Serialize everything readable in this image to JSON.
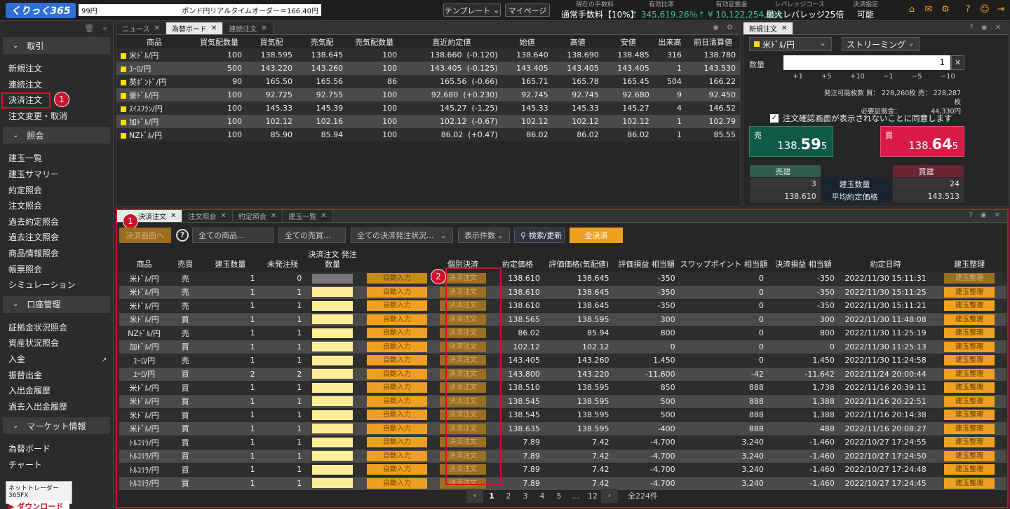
{
  "topbar": {
    "logo": "くりっく365",
    "ticker_left": "99円",
    "ticker_right": "ポンド円リアルタイムオーダー＝166.40円",
    "template_btn": "テンプレート",
    "mypage_btn": "マイページ",
    "fee_label": "現在の手数料",
    "fee_value": "通常手数料【10%】",
    "ratio_label": "有効比率",
    "ratio_value": "345,619.26％",
    "margin_label": "有効証拠金",
    "margin_value": "¥ 10,122,254,991",
    "lev_label": "レバレッジコース",
    "lev_value": "最大レバレッジ25倍",
    "settle_label": "決済指定",
    "settle_value": "可能"
  },
  "sidebar": {
    "sections": [
      {
        "title": "取引",
        "items": [
          "新規注文",
          "連続注文",
          "決済注文",
          "注文変更・取消"
        ]
      },
      {
        "title": "照会",
        "items": [
          "建玉一覧",
          "建玉サマリー",
          "約定照会",
          "注文照会",
          "過去約定照会",
          "過去注文照会",
          "商品情報照会",
          "帳票照会",
          "シミュレーション"
        ]
      },
      {
        "title": "口座管理",
        "items": [
          "証拠金状況照会",
          "資産状況照会",
          "入金",
          "振替出金",
          "入出金履歴",
          "過去入出金履歴"
        ]
      },
      {
        "title": "マーケット情報",
        "items": [
          "為替ボード",
          "チャート"
        ]
      }
    ],
    "download_label": "ネットトレーダー365FX",
    "download_btn": "ダウンロード",
    "badge1": "1"
  },
  "rateboard": {
    "tabs": [
      "ニュース",
      "為替ボード",
      "連続注文"
    ],
    "headers": [
      "商品",
      "買気配数量",
      "買気配",
      "売気配",
      "売気配数量",
      "直近約定値",
      "始値",
      "高値",
      "安値",
      "出来高",
      "前日清算値"
    ],
    "rows": [
      [
        "米ﾄﾞﾙ/円",
        "100",
        "138.595",
        "138.645",
        "100",
        "138.660",
        "(-0.120)",
        "138.640",
        "138.690",
        "138.485",
        "316",
        "138.780"
      ],
      [
        "ﾕｰﾛ/円",
        "500",
        "143.220",
        "143.260",
        "100",
        "143.405",
        "(-0.125)",
        "143.405",
        "143.405",
        "143.405",
        "1",
        "143.530"
      ],
      [
        "英ﾎﾟﾝﾄﾞ/円",
        "90",
        "165.50",
        "165.56",
        "86",
        "165.56",
        "(-0.66)",
        "165.71",
        "165.78",
        "165.45",
        "504",
        "166.22"
      ],
      [
        "豪ﾄﾞﾙ/円",
        "100",
        "92.725",
        "92.755",
        "100",
        "92.680",
        "(+0.230)",
        "92.745",
        "92.745",
        "92.680",
        "9",
        "92.450"
      ],
      [
        "ｽｲｽﾌﾗﾝ/円",
        "100",
        "145.33",
        "145.39",
        "100",
        "145.27",
        "(-1.25)",
        "145.33",
        "145.33",
        "145.27",
        "4",
        "146.52"
      ],
      [
        "加ﾄﾞﾙ/円",
        "100",
        "102.12",
        "102.16",
        "100",
        "102.12",
        "(-0.67)",
        "102.12",
        "102.12",
        "102.12",
        "1",
        "102.79"
      ],
      [
        "NZﾄﾞﾙ/円",
        "100",
        "85.90",
        "85.94",
        "100",
        "86.02",
        "(+0.47)",
        "86.02",
        "86.02",
        "86.02",
        "1",
        "85.55"
      ]
    ]
  },
  "neworder": {
    "tab": "新規注文",
    "pair": "米ﾄﾞﾙ/円",
    "mode": "ストリーミング",
    "qty_label": "数量",
    "qty_value": "1",
    "steps": [
      "+1",
      "+5",
      "+10",
      "−1",
      "−5",
      "−10"
    ],
    "avail": "発注可能枚数 買： 228,260枚 売： 228,287枚",
    "req_margin": "必要証拠金：　　　　　44,330円",
    "confirm": "注文確認画面が表示されないことに同意します",
    "sell_label": "売",
    "sell_main": "138.",
    "sell_big": "59",
    "sell_small": "5",
    "buy_label": "買",
    "buy_main": "138.",
    "buy_big": "64",
    "buy_small": "5",
    "pos_headers": [
      "売建",
      "",
      "買建"
    ],
    "pos_qty": [
      "3",
      "建玉数量",
      "24"
    ],
    "pos_avg": [
      "138.610",
      "平均約定価格",
      "143.513"
    ]
  },
  "settle": {
    "tabs": [
      "決済注文",
      "注文照会",
      "約定照会",
      "建玉一覧"
    ],
    "filters": {
      "back": "決済画面へ",
      "help": "?",
      "product": "全ての商品...",
      "side": "全ての売買...",
      "status": "全ての決済発注状況...",
      "count": "表示件数",
      "search": "検索/更新",
      "all": "全決済"
    },
    "headers": [
      "商品",
      "売買",
      "建玉数量",
      "未発注残",
      "決済注文 発注数量",
      "",
      "個別決済",
      "約定価格",
      "評価価格(気配値)",
      "評価損益 相当額",
      "スワップポイント 相当額",
      "決済損益 相当額",
      "約定日時",
      "建玉整理"
    ],
    "auto": "自動入力",
    "settle_btn": "決済注文",
    "org_btn": "建玉整理",
    "rows": [
      [
        "米ﾄﾞﾙ/円",
        "売",
        "1",
        "0",
        "138.610",
        "138.645",
        "-350",
        "0",
        "-350",
        "2022/11/30 15:11:31"
      ],
      [
        "米ﾄﾞﾙ/円",
        "売",
        "1",
        "1",
        "138.610",
        "138.645",
        "-350",
        "0",
        "-350",
        "2022/11/30 15:11:25"
      ],
      [
        "米ﾄﾞﾙ/円",
        "売",
        "1",
        "1",
        "138.610",
        "138.645",
        "-350",
        "0",
        "-350",
        "2022/11/30 15:11:21"
      ],
      [
        "米ﾄﾞﾙ/円",
        "買",
        "1",
        "1",
        "138.565",
        "138.595",
        "300",
        "0",
        "300",
        "2022/11/30 11:48:08"
      ],
      [
        "NZﾄﾞﾙ/円",
        "売",
        "1",
        "1",
        "86.02",
        "85.94",
        "800",
        "0",
        "800",
        "2022/11/30 11:25:19"
      ],
      [
        "加ﾄﾞﾙ/円",
        "買",
        "1",
        "1",
        "102.12",
        "102.12",
        "0",
        "0",
        "0",
        "2022/11/30 11:25:13"
      ],
      [
        "ﾕｰﾛ/円",
        "売",
        "1",
        "1",
        "143.405",
        "143.260",
        "1,450",
        "0",
        "1,450",
        "2022/11/30 11:24:58"
      ],
      [
        "ﾕｰﾛ/円",
        "買",
        "2",
        "2",
        "143.800",
        "143.220",
        "-11,600",
        "-42",
        "-11,642",
        "2022/11/24 20:00:44"
      ],
      [
        "米ﾄﾞﾙ/円",
        "買",
        "1",
        "1",
        "138.510",
        "138.595",
        "850",
        "888",
        "1,738",
        "2022/11/16 20:39:11"
      ],
      [
        "米ﾄﾞﾙ/円",
        "買",
        "1",
        "1",
        "138.545",
        "138.595",
        "500",
        "888",
        "1,388",
        "2022/11/16 20:22:51"
      ],
      [
        "米ﾄﾞﾙ/円",
        "買",
        "1",
        "1",
        "138.545",
        "138.595",
        "500",
        "888",
        "1,388",
        "2022/11/16 20:14:38"
      ],
      [
        "米ﾄﾞﾙ/円",
        "買",
        "1",
        "1",
        "138.635",
        "138.595",
        "-400",
        "888",
        "488",
        "2022/11/16 20:08:27"
      ],
      [
        "ﾄﾙｺﾘﾗ/円",
        "買",
        "1",
        "1",
        "7.89",
        "7.42",
        "-4,700",
        "3,240",
        "-1,460",
        "2022/10/27 17:24:55"
      ],
      [
        "ﾄﾙｺﾘﾗ/円",
        "買",
        "1",
        "1",
        "7.89",
        "7.42",
        "-4,700",
        "3,240",
        "-1,460",
        "2022/10/27 17:24:50"
      ],
      [
        "ﾄﾙｺﾘﾗ/円",
        "買",
        "1",
        "1",
        "7.89",
        "7.42",
        "-4,700",
        "3,240",
        "-1,460",
        "2022/10/27 17:24:48"
      ],
      [
        "ﾄﾙｺﾘﾗ/円",
        "買",
        "1",
        "1",
        "7.89",
        "7.42",
        "-4,700",
        "3,240",
        "-1,460",
        "2022/10/27 17:24:45"
      ]
    ],
    "pager": {
      "prev": "‹",
      "pages": [
        "1",
        "2",
        "3",
        "4",
        "5",
        "…",
        "12"
      ],
      "next": "›",
      "total": "全224件"
    },
    "badge1": "1",
    "badge2": "2"
  }
}
